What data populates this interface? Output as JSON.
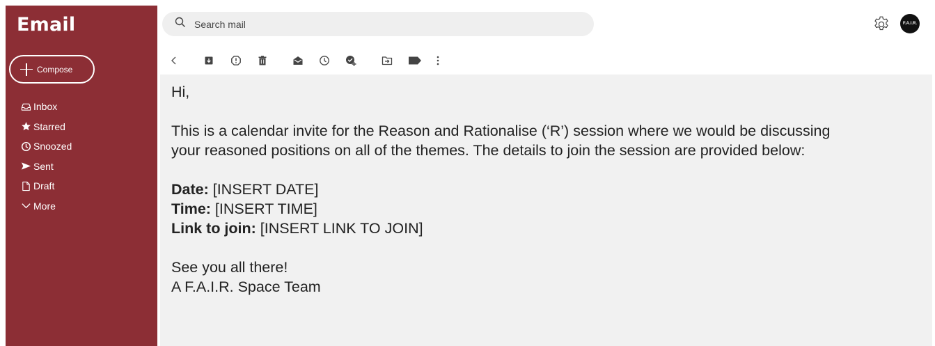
{
  "app": {
    "title": "Email"
  },
  "compose": {
    "label": "Compose"
  },
  "nav": [
    {
      "label": "Inbox",
      "icon": "inbox-icon"
    },
    {
      "label": "Starred",
      "icon": "star-icon"
    },
    {
      "label": "Snoozed",
      "icon": "clock-icon"
    },
    {
      "label": "Sent",
      "icon": "send-icon"
    },
    {
      "label": "Draft",
      "icon": "file-icon"
    },
    {
      "label": "More",
      "icon": "chevron-down-icon"
    }
  ],
  "search": {
    "placeholder": "Search mail"
  },
  "account": {
    "avatar_text": "F.A.I.R."
  },
  "toolbar": {
    "icons": [
      "back-icon",
      "archive-icon",
      "report-spam-icon",
      "delete-icon",
      "mark-unread-icon",
      "snooze-icon",
      "add-task-icon",
      "move-to-icon",
      "label-icon",
      "more-options-icon"
    ]
  },
  "message": {
    "greeting": "Hi,",
    "body_line1": "This is a calendar invite for the Reason and Rationalise (‘R’) session where we would be discussing",
    "body_line2": "your reasoned positions on all of the themes. The details to join the session are provided below:",
    "date_label": "Date:",
    "date_value": " [INSERT DATE]",
    "time_label": "Time:",
    "time_value": " [INSERT TIME]",
    "link_label": "Link to join:",
    "link_value": " [INSERT LINK TO JOIN]",
    "closing": "See you all there!",
    "signature": "A F.A.I.R. Space Team"
  },
  "colors": {
    "sidebar": "#8c2e35",
    "content_bg": "#f1f1f1",
    "search_bg": "#efefef"
  }
}
